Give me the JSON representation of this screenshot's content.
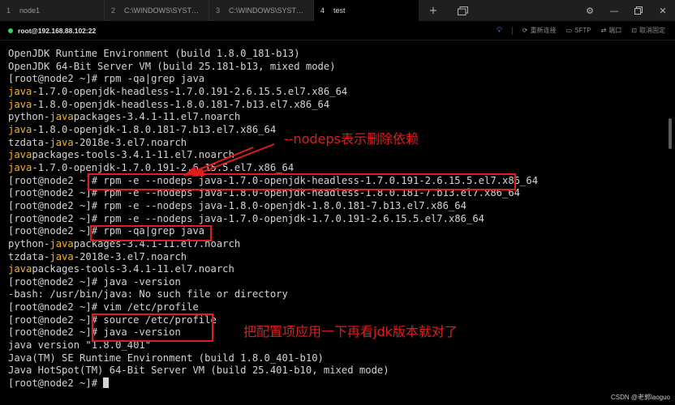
{
  "tabs": [
    {
      "num": "1",
      "title": "node1"
    },
    {
      "num": "2",
      "title": "C:\\WINDOWS\\SYSTEM..."
    },
    {
      "num": "3",
      "title": "C:\\WINDOWS\\SYSTEM..."
    },
    {
      "num": "4",
      "title": "test"
    }
  ],
  "tab_icons": {
    "add": "plus-icon",
    "layout": "window-layout-icon"
  },
  "window_icons": {
    "settings": "gear-icon",
    "minimize": "minimize-icon",
    "restore": "restore-icon",
    "close": "close-icon"
  },
  "session": {
    "label": "root@192.168.88.102:22",
    "status_color": "#3ecf5a"
  },
  "toolbar": {
    "reconnect": "重新连接",
    "sftp": "SFTP",
    "port": "端口",
    "unpin": "取消固定"
  },
  "terminal": {
    "lines": [
      [
        "OpenJDK Runtime Environment (build 1.8.0_181-b13)"
      ],
      [
        "OpenJDK 64-Bit Server VM (build 25.181-b13, mixed mode)"
      ],
      [
        "[root@node2 ~]# rpm -qa|grep java"
      ],
      [
        {
          "hl": "java"
        },
        "-1.7.0-openjdk-headless-1.7.0.191-2.6.15.5.el7.x86_64"
      ],
      [
        {
          "hl": "java"
        },
        "-1.8.0-openjdk-headless-1.8.0.181-7.b13.el7.x86_64"
      ],
      [
        "python-",
        {
          "hl": "java"
        },
        "packages-3.4.1-11.el7.noarch"
      ],
      [
        {
          "hl": "java"
        },
        "-1.8.0-openjdk-1.8.0.181-7.b13.el7.x86_64"
      ],
      [
        "tzdata-",
        {
          "hl": "java"
        },
        "-2018e-3.el7.noarch"
      ],
      [
        {
          "hl": "java"
        },
        "packages-tools-3.4.1-11.el7.noarch"
      ],
      [
        {
          "hl": "java"
        },
        "-1.7.0-openjdk-1.7.0.191-2.6.15.5.el7.x86_64"
      ],
      [
        "[root@node2 ~]# rpm -e --nodeps java-1.7.0-openjdk-headless-1.7.0.191-2.6.15.5.el7.x86_64"
      ],
      [
        "[root@node2 ~]# rpm -e --nodeps java-1.8.0-openjdk-headless-1.8.0.181-7.b13.el7.x86_64"
      ],
      [
        "[root@node2 ~]# rpm -e --nodeps java-1.8.0-openjdk-1.8.0.181-7.b13.el7.x86_64"
      ],
      [
        "[root@node2 ~]# rpm -e --nodeps java-1.7.0-openjdk-1.7.0.191-2.6.15.5.el7.x86_64"
      ],
      [
        "[root@node2 ~]# rpm -qa|grep java"
      ],
      [
        "python-",
        {
          "hl": "java"
        },
        "packages-3.4.1-11.el7.noarch"
      ],
      [
        "tzdata-",
        {
          "hl": "java"
        },
        "-2018e-3.el7.noarch"
      ],
      [
        {
          "hl": "java"
        },
        "packages-tools-3.4.1-11.el7.noarch"
      ],
      [
        "[root@node2 ~]# java -version"
      ],
      [
        "-bash: /usr/bin/java: No such file or directory"
      ],
      [
        "[root@node2 ~]# vim /etc/profile"
      ],
      [
        "[root@node2 ~]# source /etc/profile"
      ],
      [
        "[root@node2 ~]# java -version"
      ],
      [
        "java version \"1.8.0_401\""
      ],
      [
        "Java(TM) SE Runtime Environment (build 1.8.0_401-b10)"
      ],
      [
        "Java HotSpot(TM) 64-Bit Server VM (build 25.401-b10, mixed mode)"
      ],
      [
        "[root@node2 ~]# "
      ]
    ],
    "text_color": "#d4d4d4",
    "highlight_color": "#f0b428"
  },
  "annotations": {
    "nodeps_note": "--nodeps表示删除依赖",
    "profile_note": "把配置项应用一下再看jdk版本就对了",
    "color": "#e21c1c"
  },
  "watermark": "CSDN @老郭laoguo"
}
